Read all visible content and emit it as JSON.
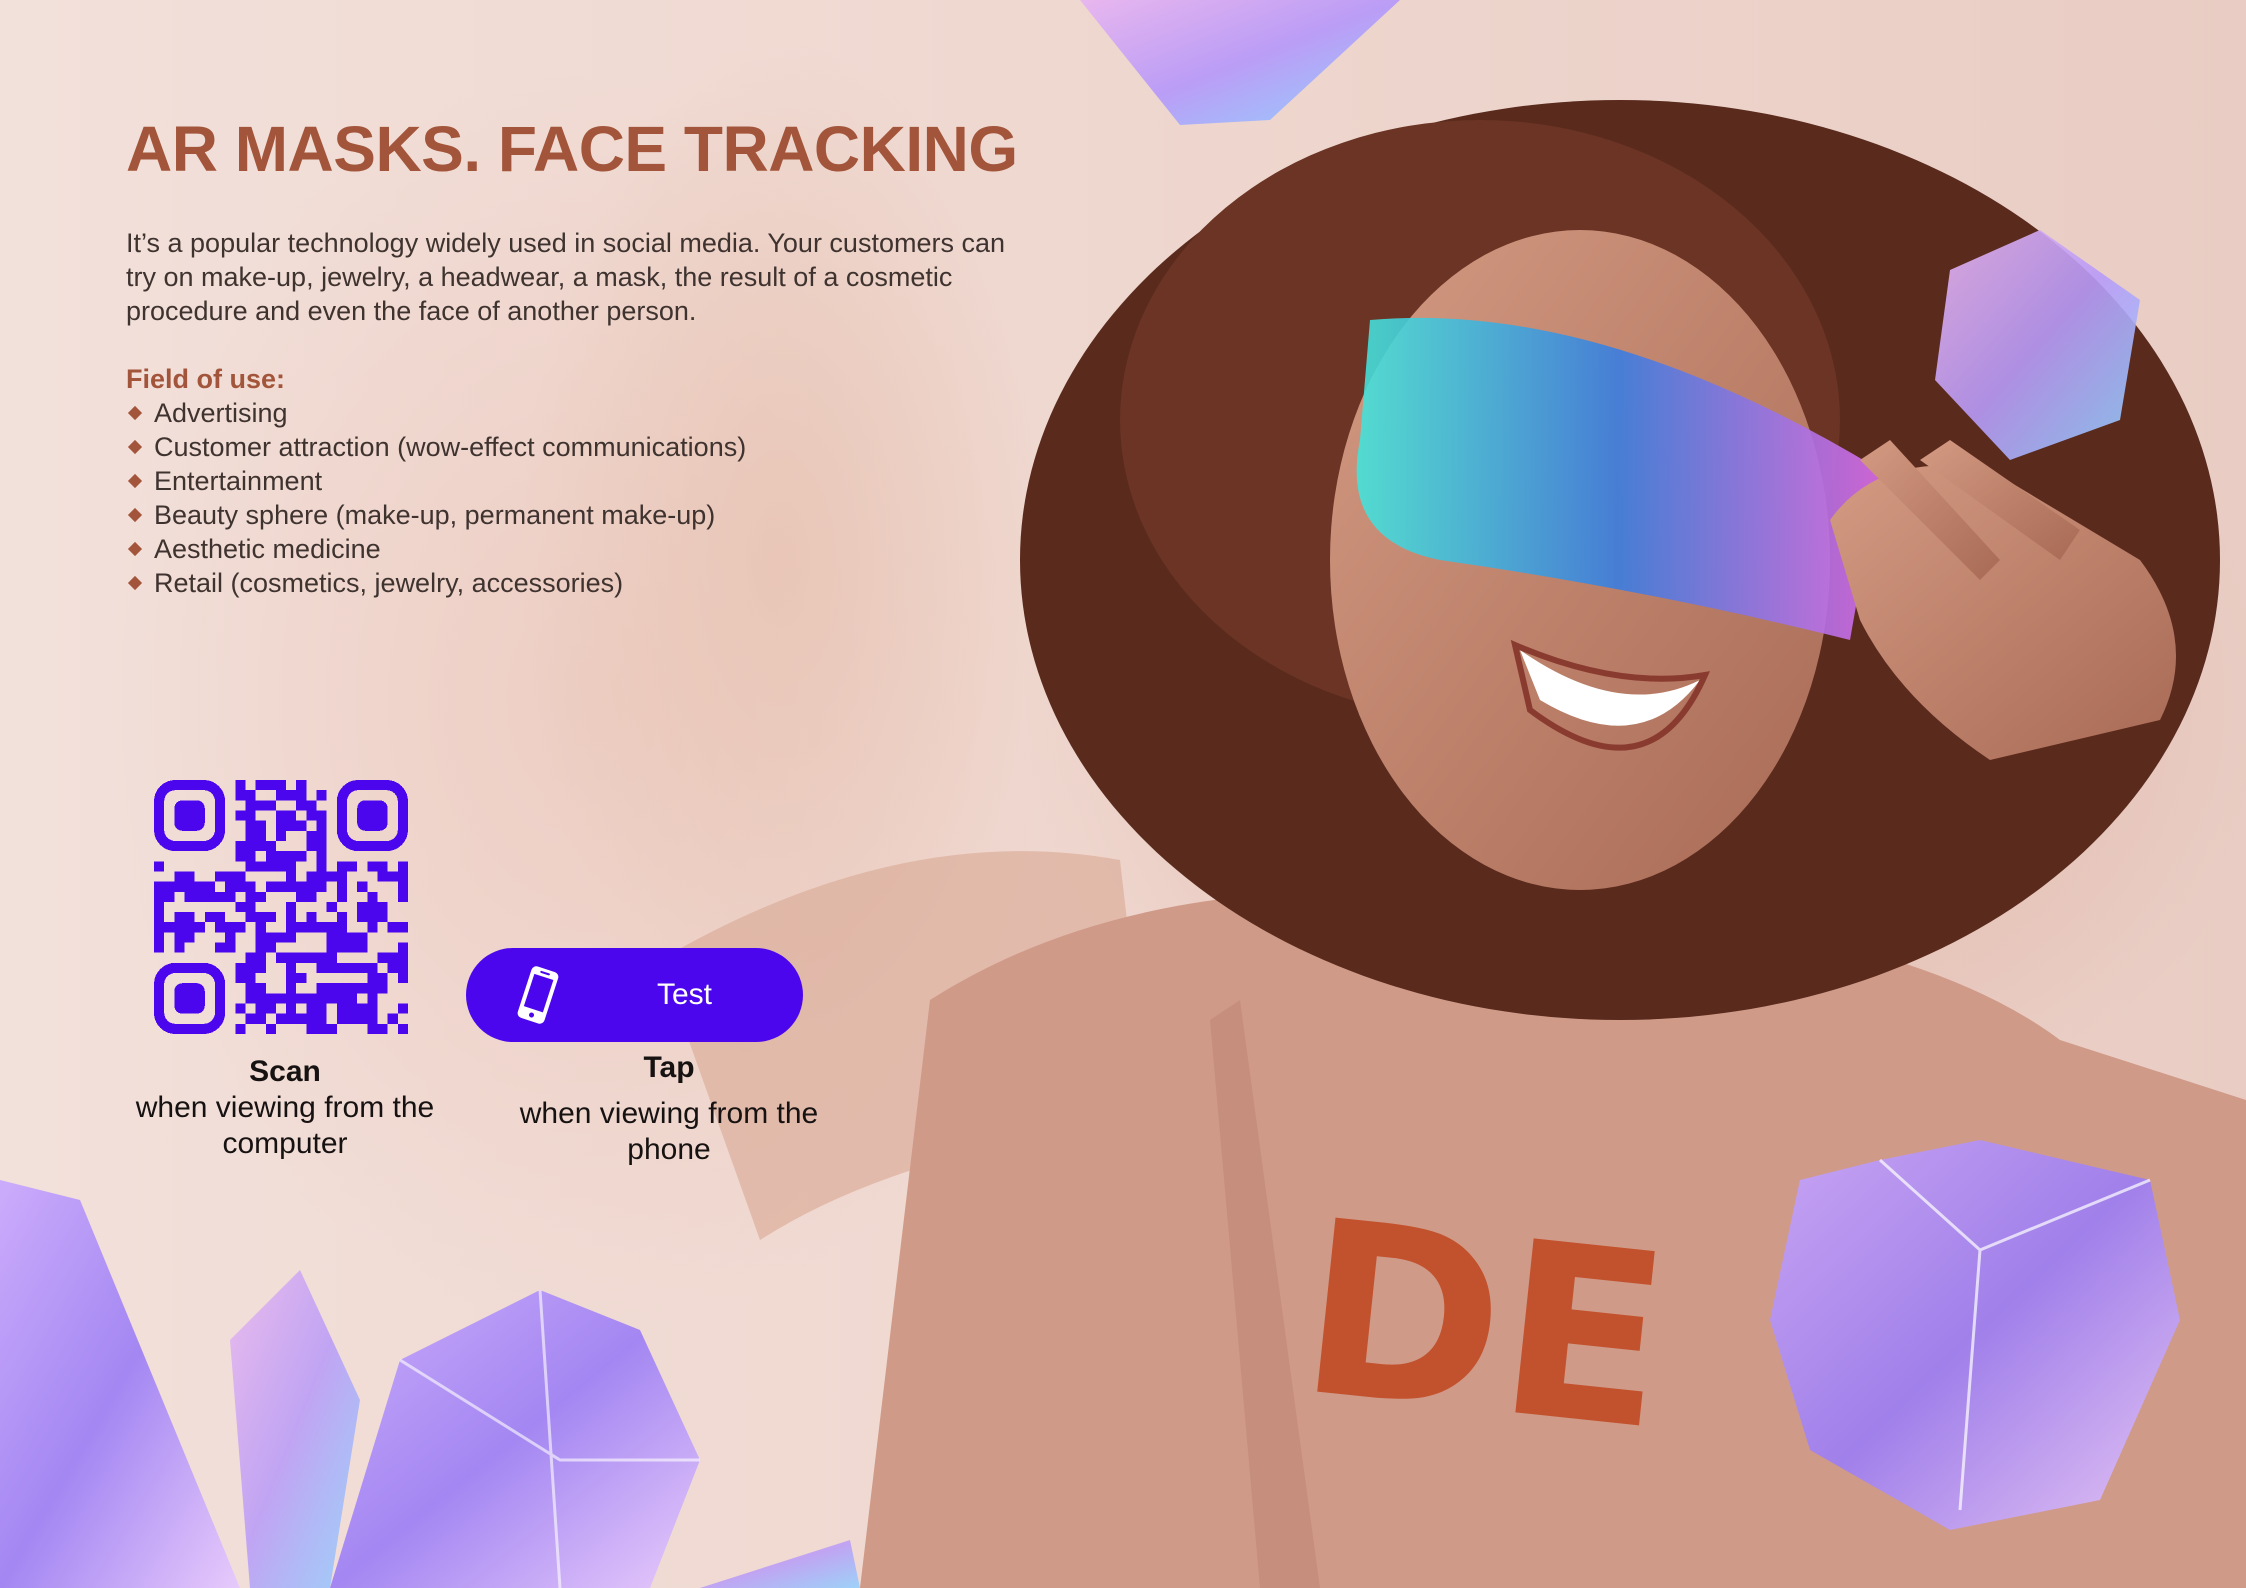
{
  "page": {
    "title": "AR MASKS. FACE TRACKING",
    "intro": "It’s a popular technology widely used in social media. Your customers can try on make-up, jewelry, a headwear, a mask, the result of a cosmetic procedure and even the face of another person.",
    "field_title": "Field of use:",
    "uses": [
      "Advertising",
      "Customer attraction (wow-effect communications)",
      "Entertainment",
      "Beauty sphere (make-up, permanent make-up)",
      "Aesthetic medicine",
      "Retail (cosmetics, jewelry, accessories)"
    ]
  },
  "scan": {
    "label": "Scan",
    "sub": "when viewing from the computer"
  },
  "tap": {
    "button_label": "Test",
    "label": "Tap",
    "sub": "when viewing from the phone",
    "icon": "phone-icon"
  },
  "colors": {
    "accent": "#a2553a",
    "button": "#4b06ee",
    "qr": "#4b06ee"
  }
}
